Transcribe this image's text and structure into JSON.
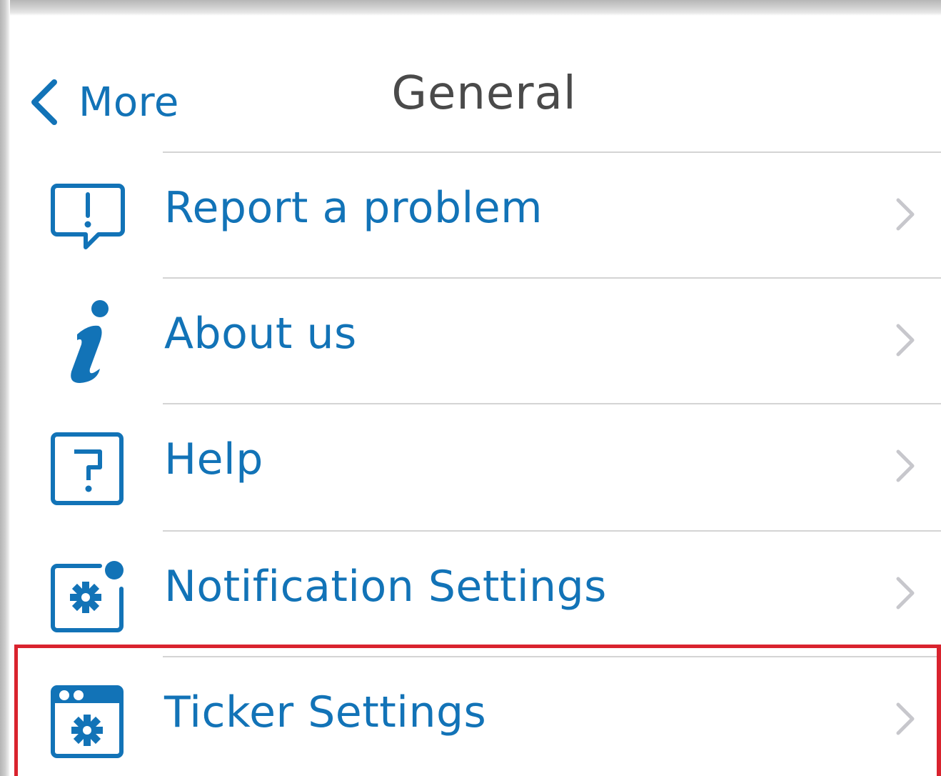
{
  "navbar": {
    "back_label": "More",
    "back_icon": "chevron-left-icon",
    "title": "General"
  },
  "menu_items": [
    {
      "label": "Report a problem",
      "icon": "report-problem-icon"
    },
    {
      "label": "About us",
      "icon": "info-icon"
    },
    {
      "label": "Help",
      "icon": "help-icon"
    },
    {
      "label": "Notification Settings",
      "icon": "notification-settings-icon"
    },
    {
      "label": "Ticker Settings",
      "icon": "ticker-settings-icon",
      "highlighted": true
    }
  ],
  "colors": {
    "accent": "#1273b7",
    "title": "#4a4a4a",
    "separator": "#d4d4d4",
    "chevron": "#c7c7cc",
    "highlight": "#d9232e"
  }
}
